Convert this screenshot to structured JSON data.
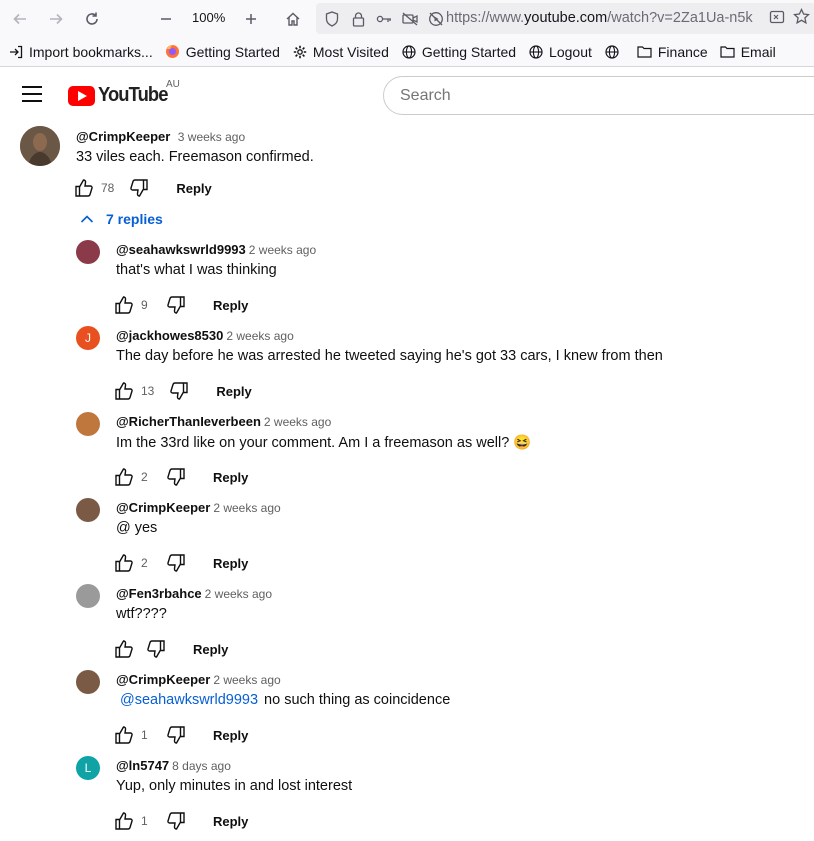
{
  "browser": {
    "zoom": "100%",
    "url_prefix": "https://www.",
    "url_domain": "youtube.com",
    "url_suffix": "/watch?v=2Za1Ua-n5k"
  },
  "bookmarks": [
    {
      "label": "Import bookmarks...",
      "icon": "import-icon"
    },
    {
      "label": "Getting Started",
      "icon": "firefox-icon"
    },
    {
      "label": "Most Visited",
      "icon": "gear-icon"
    },
    {
      "label": "Getting Started",
      "icon": "globe-icon"
    },
    {
      "label": "Logout",
      "icon": "globe-icon"
    },
    {
      "label": "",
      "icon": "globe-icon"
    },
    {
      "label": "Finance",
      "icon": "folder-icon"
    },
    {
      "label": "Email",
      "icon": "folder-icon"
    }
  ],
  "youtube": {
    "logo_text": "YouTube",
    "country": "AU",
    "search_placeholder": "Search"
  },
  "top_comment": {
    "author": "@CrimpKeeper",
    "when": "3 weeks ago",
    "text": "33 viles each. Freemason confirmed.",
    "likes": "78",
    "reply_label": "Reply"
  },
  "replies_toggle": "7 replies",
  "replies": [
    {
      "author": "@seahawkswrld9993",
      "when": "2 weeks ago",
      "text": "that's what I was thinking",
      "likes": "9",
      "reply_label": "Reply",
      "avatar_color": "#8b3a4a",
      "avatar_letter": ""
    },
    {
      "author": "@jackhowes8530",
      "when": "2 weeks ago",
      "text": "The day before he was arrested he tweeted saying he's got 33 cars, I knew from then",
      "likes": "13",
      "reply_label": "Reply",
      "avatar_color": "#e8501f",
      "avatar_letter": "J"
    },
    {
      "author": "@RicherThanIeverbeen",
      "when": "2 weeks ago",
      "text": "Im the 33rd like on your comment. Am I a freemason as well? 😆",
      "likes": "2",
      "reply_label": "Reply",
      "avatar_color": "#c0773e",
      "avatar_letter": ""
    },
    {
      "author": "@CrimpKeeper",
      "when": "2 weeks ago",
      "text": "@ yes",
      "likes": "2",
      "reply_label": "Reply",
      "avatar_color": "#7a5a44",
      "avatar_letter": ""
    },
    {
      "author": "@Fen3rbahce",
      "when": "2 weeks ago",
      "text": "wtf????",
      "likes": "",
      "reply_label": "Reply",
      "avatar_color": "#9a9a9a",
      "avatar_letter": ""
    },
    {
      "author": "@CrimpKeeper",
      "when": "2 weeks ago",
      "mention": "@seahawkswrld9993",
      "text": "no such thing as coincidence",
      "likes": "1",
      "reply_label": "Reply",
      "avatar_color": "#7a5a44",
      "avatar_letter": ""
    },
    {
      "author": "@ln5747",
      "when": "8 days ago",
      "text": "Yup, only minutes in and lost interest",
      "likes": "1",
      "reply_label": "Reply",
      "avatar_color": "#10a3a6",
      "avatar_letter": "L"
    }
  ]
}
